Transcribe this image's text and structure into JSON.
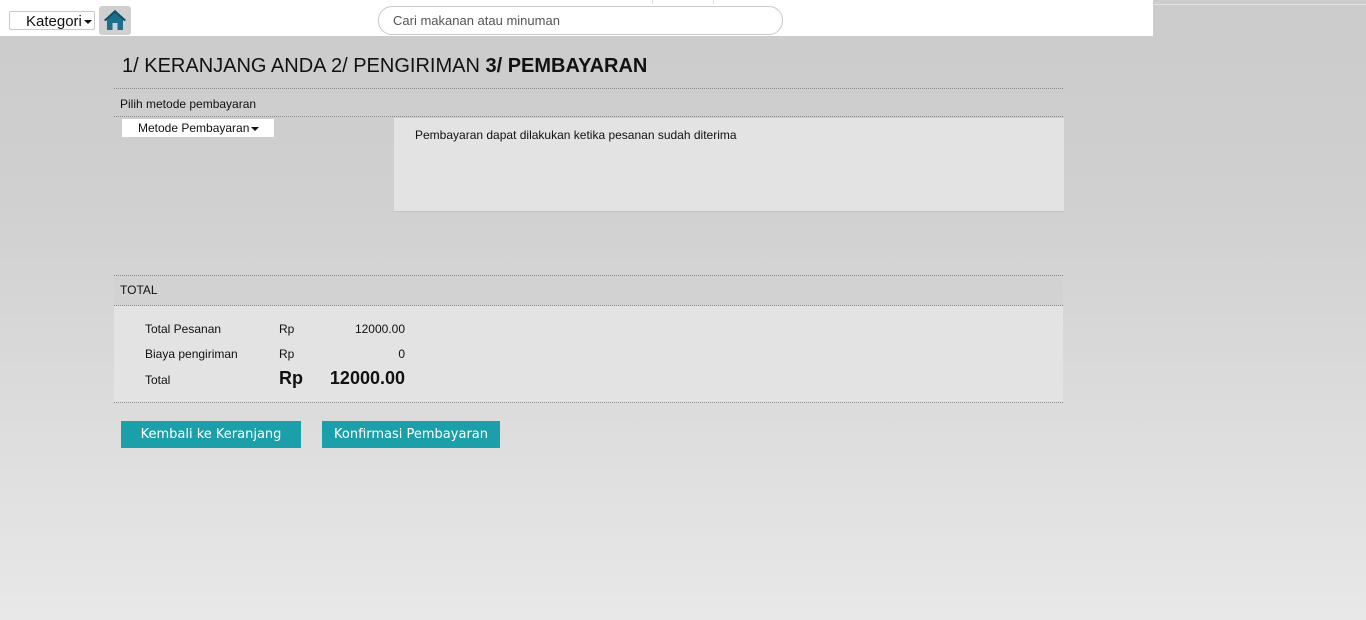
{
  "topbar": {
    "category_label": "Kategori",
    "search_placeholder": "Cari makanan atau minuman"
  },
  "steps": {
    "step1": "1/ KERANJANG ANDA",
    "step2": "2/ PENGIRIMAN",
    "step3": "3/ PEMBAYARAN",
    "active_step": 3
  },
  "payment": {
    "section_label": "Pilih metode pembayaran",
    "method_select_label": "Metode Pembayaran",
    "info_text": "Pembayaran dapat dilakukan ketika pesanan sudah diterima"
  },
  "total": {
    "header": "TOTAL",
    "rows": [
      {
        "label": "Total Pesanan",
        "currency": "Rp",
        "value": "12000.00"
      },
      {
        "label": "Biaya pengiriman",
        "currency": "Rp",
        "value": "0"
      },
      {
        "label": "Total",
        "currency": "Rp",
        "value": "12000.00"
      }
    ]
  },
  "actions": {
    "back_label": "Kembali ke Keranjang",
    "confirm_label": "Konfirmasi Pembayaran"
  },
  "colors": {
    "button": "#1b9fa9",
    "home_icon": "#1b6f8c"
  }
}
